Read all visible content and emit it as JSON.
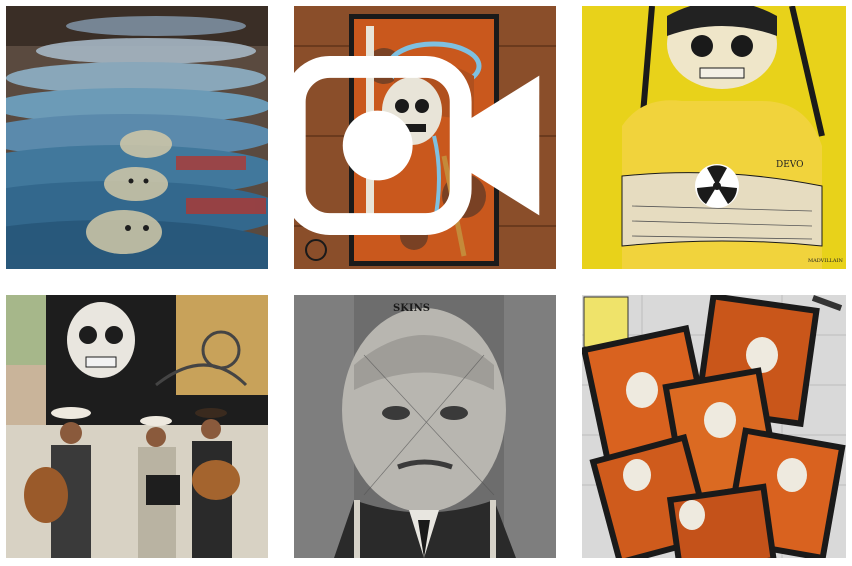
{
  "grid": {
    "tiles": [
      {
        "id": 1,
        "subject": "stacked skateboard decks with portrait artwork",
        "is_video": false
      },
      {
        "id": 2,
        "subject": "skull girl painting on orange panel over wood",
        "is_video": true
      },
      {
        "id": 3,
        "subject": "skull girl in yellow shirt with radiation symbol",
        "is_video": false
      },
      {
        "id": 4,
        "subject": "three musicians in cowboy hats under skull mural",
        "is_video": false
      },
      {
        "id": 5,
        "subject": "collage portrait of a man in suit",
        "is_video": false
      },
      {
        "id": 6,
        "subject": "scattered prints of skull girl artwork",
        "is_video": false
      }
    ],
    "video_icon": "video-camera-icon"
  },
  "texts": {
    "portrait_caption": "SKINS",
    "shirt_tag": "DEVO",
    "sticker": "MADVILLAIN"
  },
  "colors": {
    "accent_orange": "#d9621f",
    "yellow": "#e8d21a",
    "wood": "#8a4e2a"
  }
}
